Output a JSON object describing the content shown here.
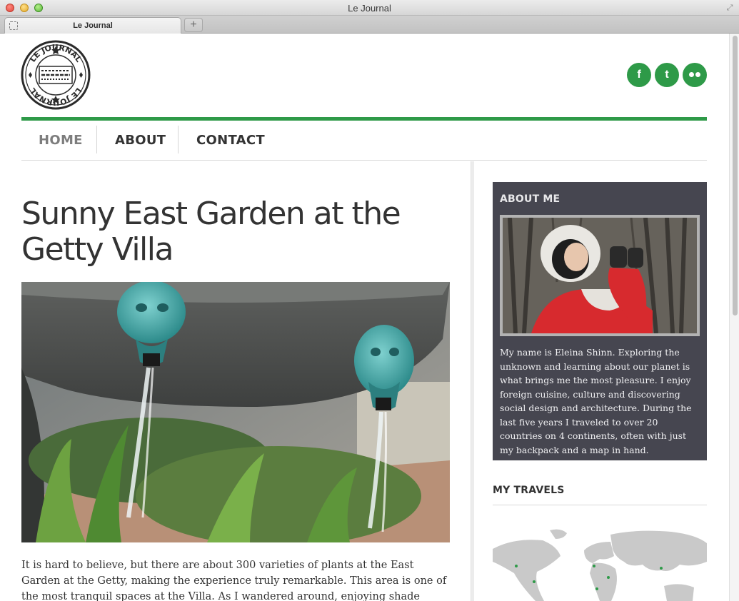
{
  "window": {
    "title": "Le Journal"
  },
  "tab": {
    "label": "Le Journal",
    "new_tab_glyph": "+"
  },
  "logo": {
    "text": "LE JOURNAL",
    "alt": "Le Journal stamp logo"
  },
  "social": [
    {
      "name": "facebook",
      "glyph": "f"
    },
    {
      "name": "twitter",
      "glyph": "t"
    },
    {
      "name": "flickr",
      "glyph": ""
    }
  ],
  "nav": {
    "items": [
      "HOME",
      "ABOUT",
      "CONTACT"
    ],
    "active": "HOME"
  },
  "post": {
    "title": "Sunny East Garden at the Getty Villa",
    "body": "It is hard to believe, but there are about 300 varieties of plants at the East Garden at the Getty, making the experience truly remarkable. This area is one of the most tranquil spaces at the Villa. As I wandered around, enjoying shade provided by"
  },
  "sidebar": {
    "about_heading": "ABOUT ME",
    "about_text": "My name is Eleina Shinn. Exploring the unknown and learning about our planet is what brings me the most pleasure. I enjoy foreign cuisine, culture and discovering social design and architecture. During the last five years I traveled to over 20 countries on 4 continents, often with just my backpack and a map in hand.",
    "travels_heading": "MY TRAVELS"
  },
  "colors": {
    "accent": "#2e9a48",
    "about_bg": "#464650",
    "text": "#333333",
    "nav_active": "#7d7d7d"
  },
  "icons": [
    "facebook-icon",
    "twitter-icon",
    "flickr-icon",
    "plus-icon",
    "fullscreen-icon"
  ]
}
